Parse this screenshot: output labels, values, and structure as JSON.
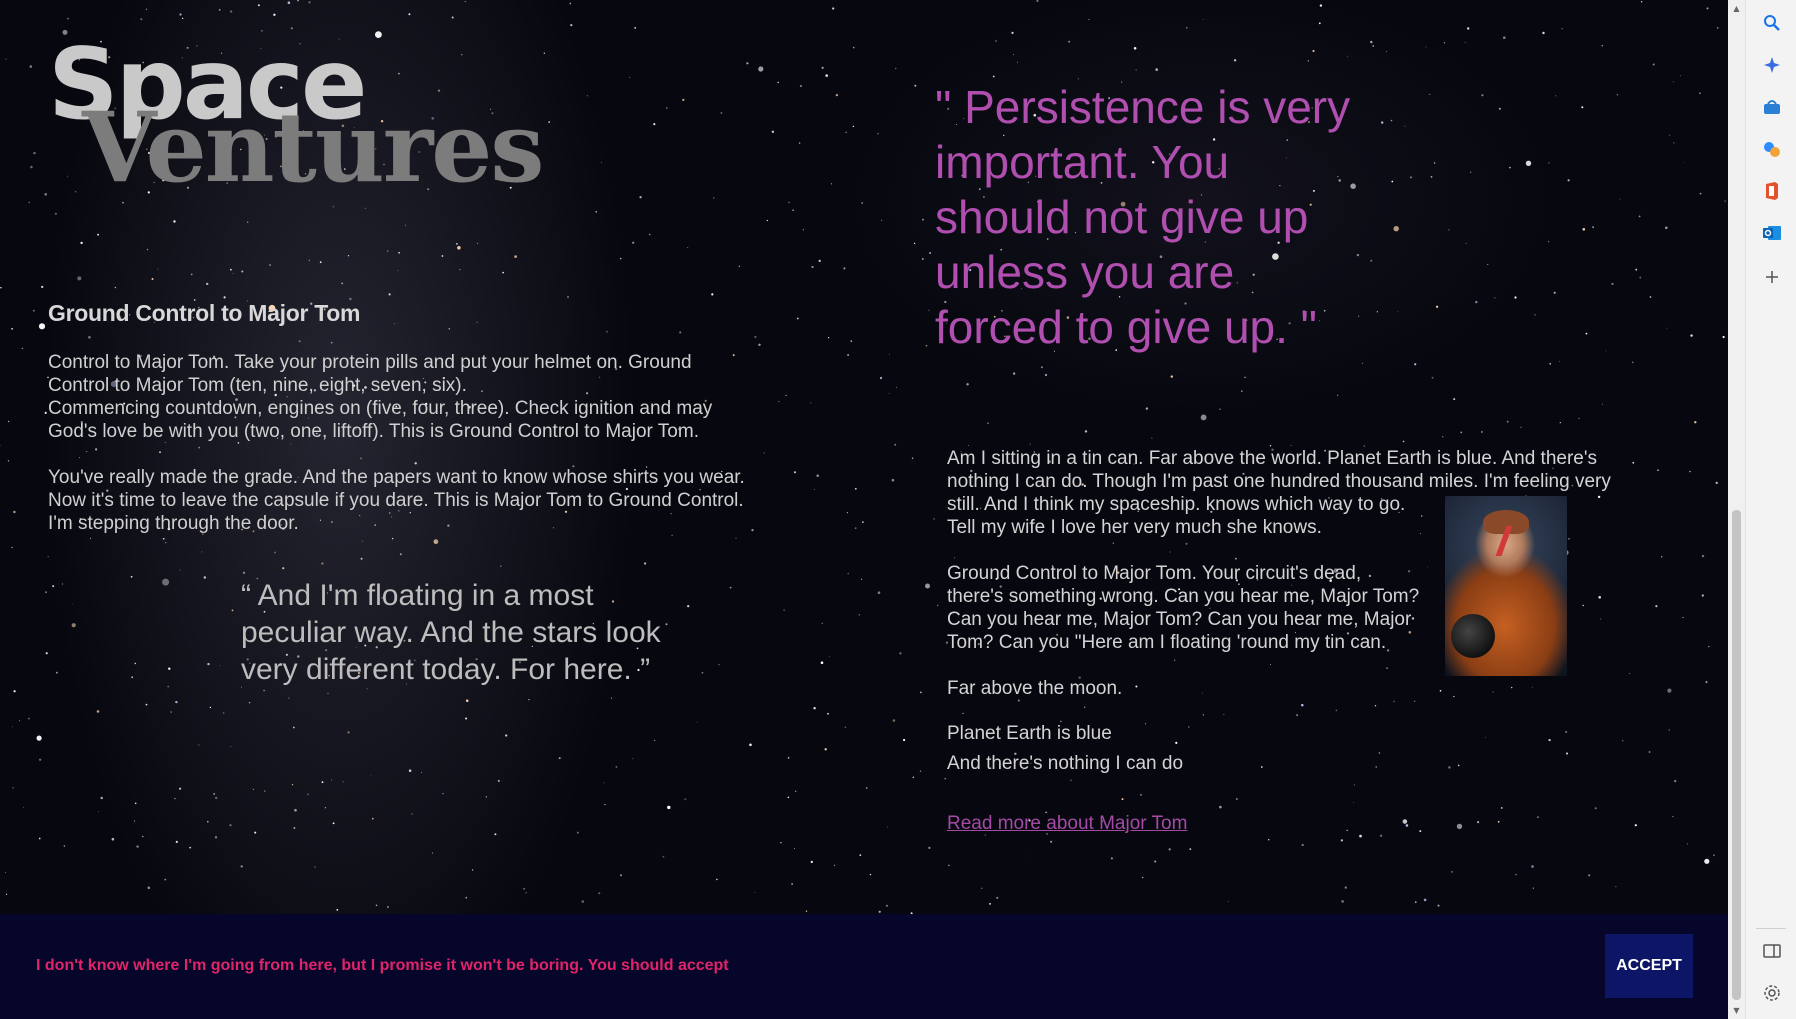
{
  "brand": {
    "line1": "Space",
    "line2": "Ventures"
  },
  "left": {
    "heading": "Ground Control to Major Tom",
    "paragraphs": [
      [
        "Control to Major Tom. Take your protein pills and put your helmet on. Ground",
        "Control to Major Tom (ten, nine, eight, seven, six).",
        "Commencing countdown, engines on (five, four, three). Check ignition and may",
        "God's love be with you (two, one, liftoff). This is Ground Control to Major Tom."
      ],
      [
        "You've really made the grade. And the papers want to know whose shirts you wear.",
        "Now it's time to leave the capsule if you dare. This is Major Tom to Ground Control.",
        "I'm stepping through the door."
      ]
    ],
    "quote_lines": [
      "“ And I'm floating in a most",
      "peculiar way. And the stars look",
      "very different today. For here. ”"
    ]
  },
  "right": {
    "quote_lines": [
      "\" Persistence is very",
      "important. You",
      "should not give up",
      "unless you are",
      "forced to give up. \""
    ],
    "paragraphs": [
      [
        "Am I sitting in a tin can. Far above the world. Planet Earth is blue. And there's",
        "nothing I can do. Though I'm past one hundred thousand miles. I'm feeling very",
        "still. And I think my spaceship. knows which way to go.",
        "Tell my wife I love her very much she knows."
      ],
      [
        "Ground Control to Major Tom. Your circuit's dead,",
        "there's something wrong. Can you hear me, Major Tom?",
        "Can you hear me, Major Tom? Can you hear me, Major",
        "Tom? Can you \"Here am I floating 'round my tin can."
      ]
    ],
    "far_above": "Far above the moon.",
    "planet_lines": [
      "Planet Earth is blue",
      "And there's nothing I can do"
    ],
    "read_more": "Read more about Major Tom"
  },
  "cookie": {
    "text": "I don't know where I'm going from here, but I promise it won't be boring. You should accept",
    "accept_label": "ACCEPT"
  },
  "colors": {
    "quote_accent": "#b14fb0",
    "link": "#a44aa6",
    "cookie_text": "#e0246a",
    "cookie_bg": "#06062a",
    "accept_bg": "#0d1566"
  },
  "browser_sidebar": {
    "icons": [
      "search-icon",
      "copilot-sparkle-icon",
      "shopping-bag-icon",
      "games-icon",
      "office-icon",
      "outlook-icon",
      "add-icon",
      "split-screen-icon",
      "settings-icon"
    ]
  }
}
